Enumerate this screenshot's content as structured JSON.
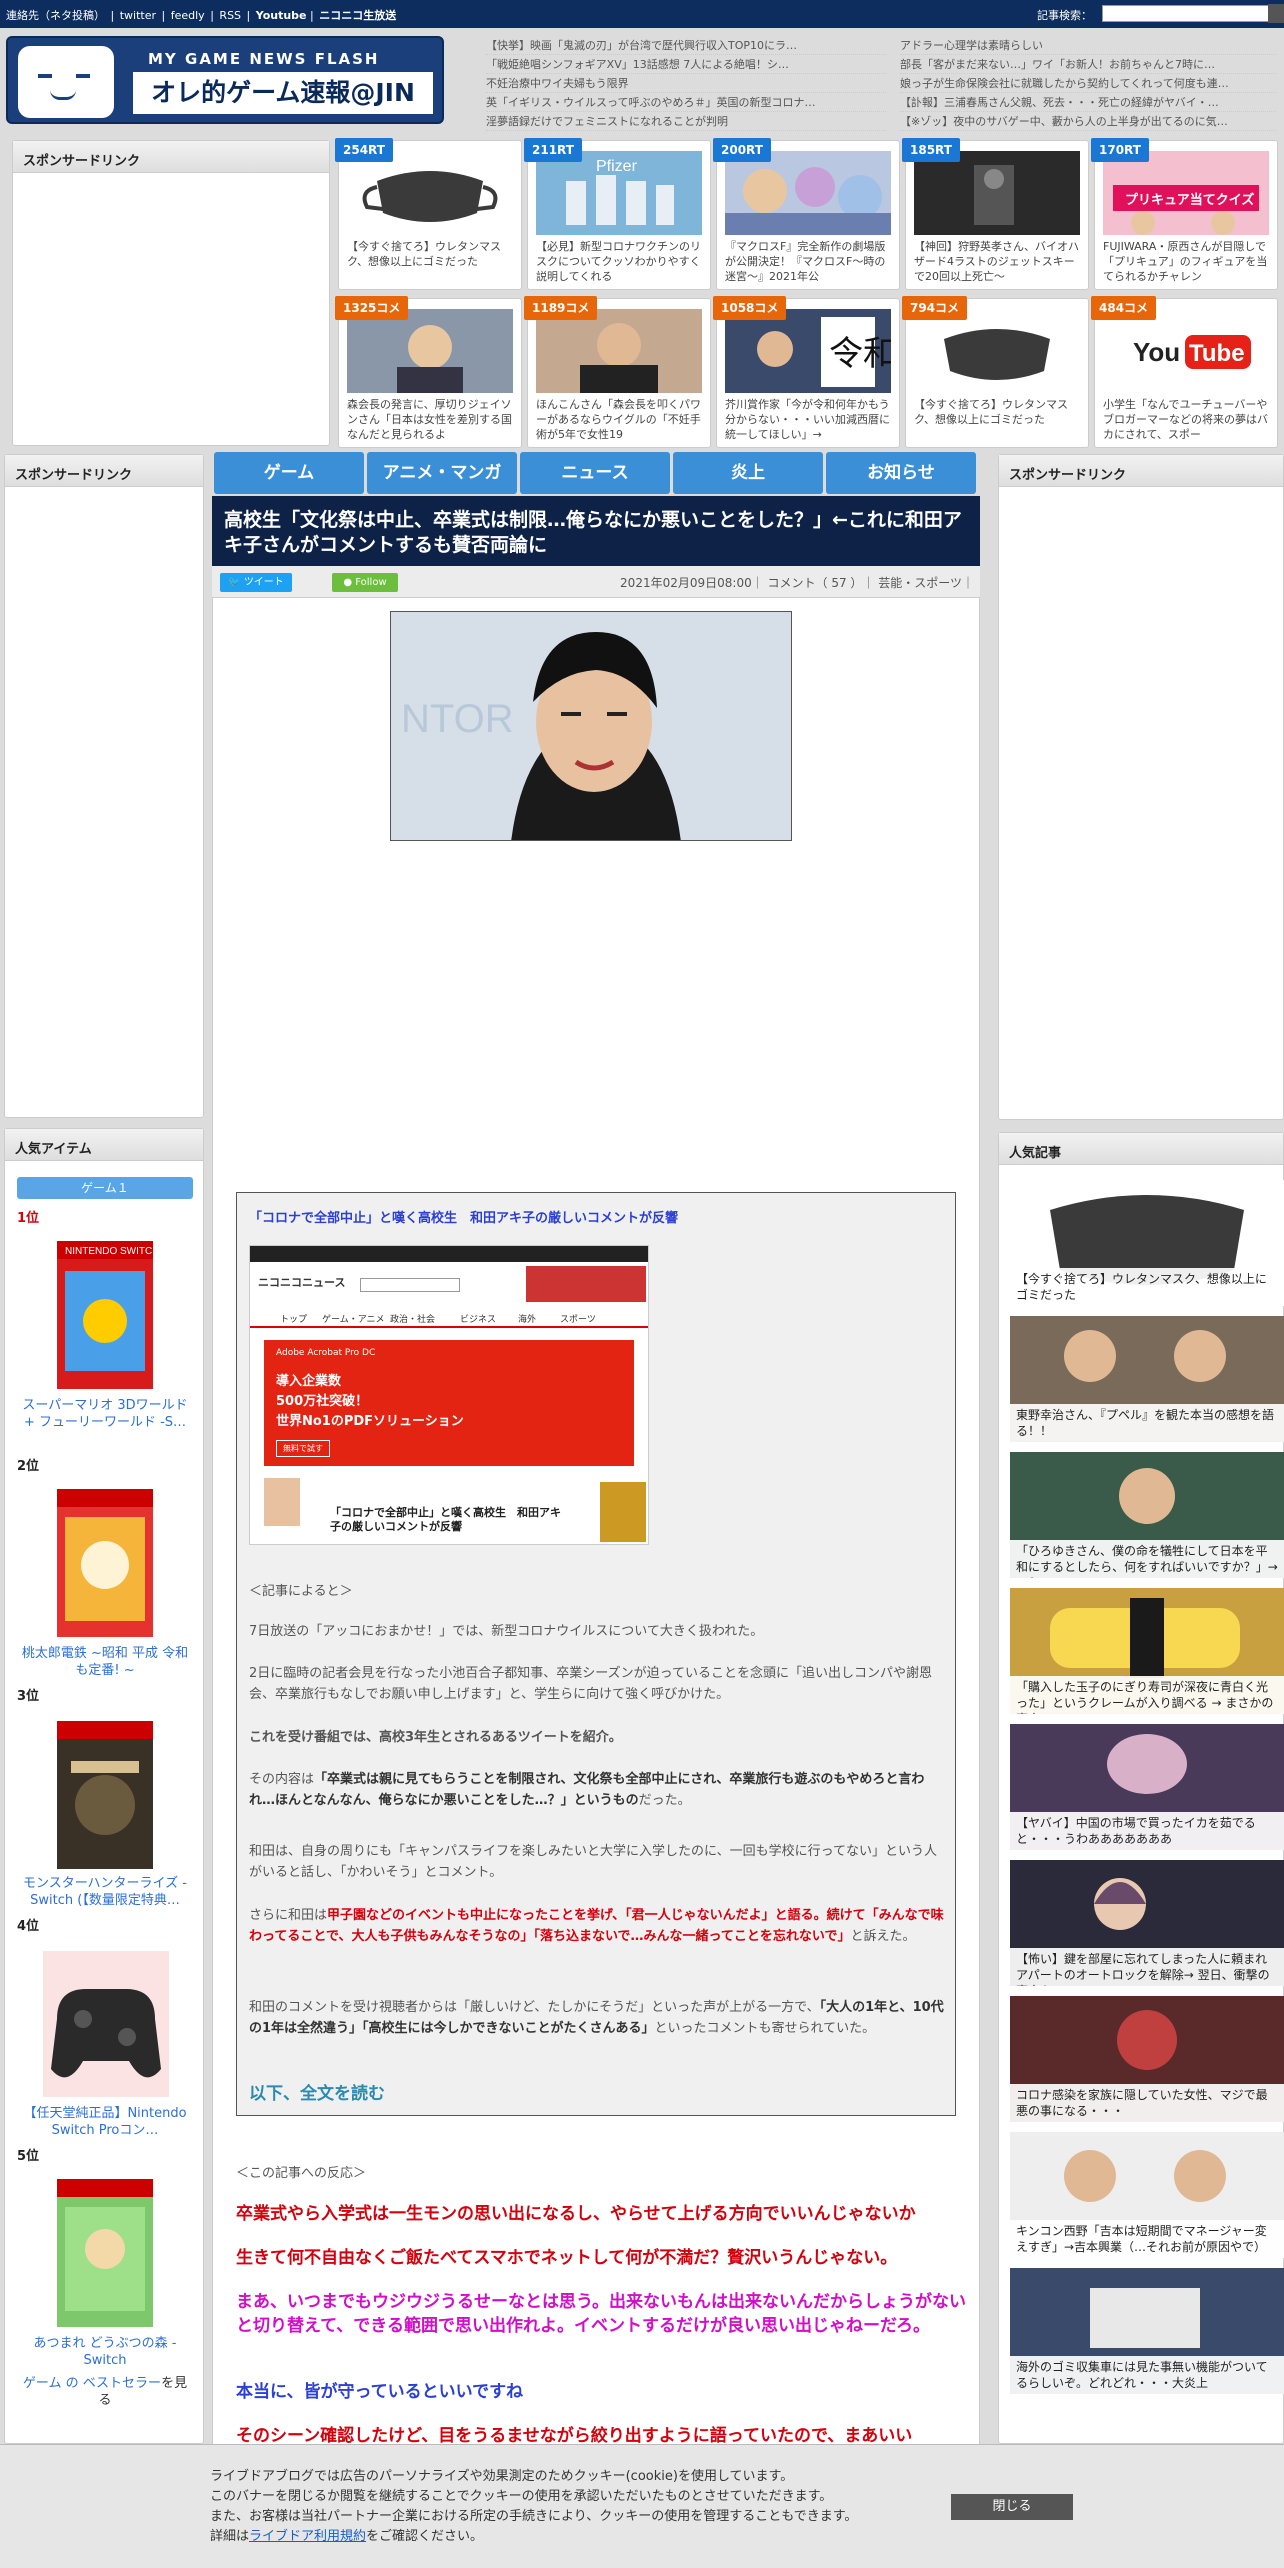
{
  "topbar": {
    "links": [
      "連絡先（ネタ投稿）",
      "|",
      "twitter",
      "|",
      "feedly",
      "|",
      "RSS",
      "|",
      "Youtube",
      "|",
      "ニコニコ生放送"
    ],
    "search_label": "記事検索："
  },
  "logo": {
    "sub": "MY GAME NEWS FLASH",
    "main": "オレ的ゲーム速報@JIN"
  },
  "header_news_left": [
    "【快挙】映画「鬼滅の刃」が台湾で歴代興行収入TOP10にラ…",
    "「戦姫絶唱シンフォギアXV」13話感想 7人による絶唱！シ…",
    "不妊治療中ワイ夫婦もう限界",
    "英「イギリス・ウイルスって呼ぶのやめろ＃」英国の新型コロナ…",
    "淫夢語録だけでフェミニストになれることが判明"
  ],
  "header_news_right": [
    "アドラー心理学は素晴らしい",
    "部長「客がまだ来ない…」ワイ「お新人！お前ちゃんと7時に…",
    "娘っ子が生命保険会社に就職したから契約してくれって何度も連…",
    "【訃報】三浦春馬さん父親、死去・・・死亡の経緯がヤバイ・…",
    "【※ゾッ】夜中のサバゲー中、藪から人の上半身が出てるのに気…"
  ],
  "sponsor_label": "スポンサードリンク",
  "rt_cards": [
    {
      "badge": "254RT",
      "caption": "【今すぐ捨てろ】ウレタンマスク、想像以上にゴミだった"
    },
    {
      "badge": "211RT",
      "caption": "【必見】新型コロナワクチンのリスクについてクッソわかりやすく説明してくれる"
    },
    {
      "badge": "200RT",
      "caption": "『マクロスF』完全新作の劇場版が公開決定！『マクロスF～時の迷宮～』2021年公"
    },
    {
      "badge": "185RT",
      "caption": "【神回】狩野英孝さん、バイオハザード4ラストのジェットスキーで20回以上死亡～"
    },
    {
      "badge": "170RT",
      "caption": "FUJIWARA・原西さんが目隠しで「プリキュア」のフィギュアを当てられるかチャレン"
    }
  ],
  "comment_cards": [
    {
      "badge": "1325コメ",
      "caption": "森会長の発言に、厚切りジェイソンさん「日本は女性を差別する国なんだと見られるよ"
    },
    {
      "badge": "1189コメ",
      "caption": "ほんこんさん「森会長を叩くパワーがあるならウイグルの「不妊手術が5年で女性19"
    },
    {
      "badge": "1058コメ",
      "caption": "芥川賞作家「今が令和何年かもう分からない・・・いい加減西暦に統一してほしい」→"
    },
    {
      "badge": "794コメ",
      "caption": "【今すぐ捨てろ】ウレタンマスク、想像以上にゴミだった"
    },
    {
      "badge": "484コメ",
      "caption": "小学生「なんでユーチューバーやブロガーマーなどの将来の夢はバカにされて、スポー"
    }
  ],
  "nav": [
    "ゲーム",
    "アニメ・マンガ",
    "ニュース",
    "炎上",
    "お知らせ"
  ],
  "article": {
    "title": "高校生「文化祭は中止、卒業式は制限…俺らなにか悪いことをした？」←これに和田アキ子さんがコメントするも賛否両論に",
    "tweet": "ツイート",
    "follow": "Follow",
    "meta": "2021年02月09日08:00｜ コメント（ 57 ）｜ 芸能・スポーツ｜"
  },
  "quote": {
    "headline": "「コロナで全部中止」と嘆く高校生　和田アキ子の厳しいコメントが反響",
    "nico_title": "「コロナで全部中止」と嘆く高校生　和田アキ子の厳しいコメントが反響",
    "nico_nav": [
      "トップ",
      "ゲーム・アニメ",
      "政治・社会",
      "ビジネス",
      "海外",
      "スポーツ"
    ],
    "nico_logo": "ニコニコニュース",
    "ad_brand": "Adobe Acrobat Pro DC",
    "ad_line1": "導入企業数",
    "ad_line2": "500万社突破！",
    "ad_line3": "世界No1のPDFソリューション",
    "ad_btn": "無料で試す",
    "intro": "＜記事によると＞",
    "p1": "7日放送の「アッコにおまかせ！」では、新型コロナウイルスについて大きく扱われた。",
    "p2": "2日に臨時の記者会見を行なった小池百合子都知事、卒業シーズンが迫っていることを念頭に「追い出しコンパや謝恩会、卒業旅行もなしでお願い申し上げます」と、学生らに向けて強く呼びかけた。",
    "p3": "これを受け番組では、高校3年生とされるあるツイートを紹介。",
    "p4a": "その内容は",
    "p4b": "「卒業式は親に見てもらうことを制限され、文化祭も全部中止にされ、卒業旅行も遊ぶのもやめろと言われ…ほんとなんなん、俺らなにか悪いことをした…？」というもの",
    "p4c": "だった。",
    "p5": "和田は、自身の周りにも「キャンパスライフを楽しみたいと大学に入学したのに、一回も学校に行ってない」という人がいると話し、「かわいそう」とコメント。",
    "p6a": "さらに和田は",
    "p6b": "甲子園などのイベントも中止になったことを挙げ、「君一人じゃないんだよ」と語る。続けて「みんなで味わってることで、大人も子供もみんなそうなの」「落ち込まないで…みんな一緒ってことを忘れないで」",
    "p6c": "と訴えた。",
    "p7a": "和田のコメントを受け視聴者からは「厳しいけど、たしかにそうだ」といった声が上がる一方で、",
    "p7b": "「大人の1年と、10代の1年は全然違う」「高校生には今しかできないことがたくさんある」",
    "p7c": "といったコメントも寄せられていた。",
    "more": "以下、全文を読む"
  },
  "reactions": {
    "label": "＜この記事への反応＞",
    "r1": "卒業式やら入学式は一生モンの思い出になるし、やらせて上げる方向でいいんじゃないか",
    "r2": "生きて何不自由なくご飯たべてスマホでネットして何が不満だ？贅沢いうんじゃない。",
    "r3": "まあ、いつまでもウジウジうるせーなとは思う。出来ないもんは出来ないんだからしょうがないと切り替えて、できる範囲で思い出作れよ。イベントするだけが良い思い出じゃねーだろ。",
    "r4": "本当に、皆が守っているといいですね",
    "r5": "そのシーン確認したけど、目をうるませながら絞り出すように語っていたので、まあいい"
  },
  "left_sidebar": {
    "sponsor": "スポンサードリンク",
    "popular_items": "人気アイテム",
    "tab": "ゲーム１",
    "items": [
      {
        "rank": "1位",
        "name": "スーパーマリオ 3Dワールド + フューリーワールド -S…"
      },
      {
        "rank": "2位",
        "name": "桃太郎電鉄 ~昭和 平成 令和も定番! ~"
      },
      {
        "rank": "3位",
        "name": "モンスターハンターライズ -Switch (【数量限定特典…"
      },
      {
        "rank": "4位",
        "name": "【任天堂純正品】Nintendo Switch Proコン…"
      },
      {
        "rank": "5位",
        "name": "あつまれ どうぶつの森 -Switch"
      }
    ],
    "bestseller_a": "ゲーム の ベストセラー",
    "bestseller_b": "を見る"
  },
  "right_sidebar": {
    "sponsor": "スポンサードリンク",
    "popular": "人気記事",
    "items": [
      "【今すぐ捨てろ】ウレタンマスク、想像以上にゴミだった",
      "東野幸治さん、『プペル』を観た本当の感想を語る！！",
      "「ひろゆきさん、僕の命を犠牲にして日本を平和にするとしたら、何をすればいいですか？」→これ",
      "「購入した玉子のにぎり寿司が深夜に青白く光った」というクレームが入り調べる → まさかの事実",
      "【ヤバイ】中国の市場で買ったイカを茹でると・・・うわあああああああ",
      "【怖い】鍵を部屋に忘れてしまった人に頼まれアパートのオートロックを解除→ 翌日、衝撃の事実を",
      "コロナ感染を家族に隠していた女性、マジで最悪の事になる・・・",
      "キンコン西野「吉本は短期間でマネージャー変えすぎ」→吉本興業（…それお前が原因やで）",
      "海外のゴミ収集車には見た事無い機能がついてるらしいぞ。どれどれ・・・大炎上"
    ]
  },
  "cookie": {
    "l1": "ライブドアブログでは広告のパーソナライズや効果測定のためクッキー(cookie)を使用しています。",
    "l2": "このバナーを閉じるか閲覧を継続することでクッキーの使用を承認いただいたものとさせていただきます。",
    "l3": "また、お客様は当社パートナー企業における所定の手続きにより、クッキーの使用を管理することもできます。",
    "l4a": "詳細は",
    "l4link": "ライブドア利用規約",
    "l4b": "をご確認ください。",
    "close": "閉じる"
  },
  "colors": {
    "navy": "#0d2d5e",
    "nav_blue": "#3a8fd6",
    "red": "#d4000c",
    "purple": "#6a2ecf",
    "magenta": "#d10fc8",
    "blue_text": "#2b3fd6"
  }
}
